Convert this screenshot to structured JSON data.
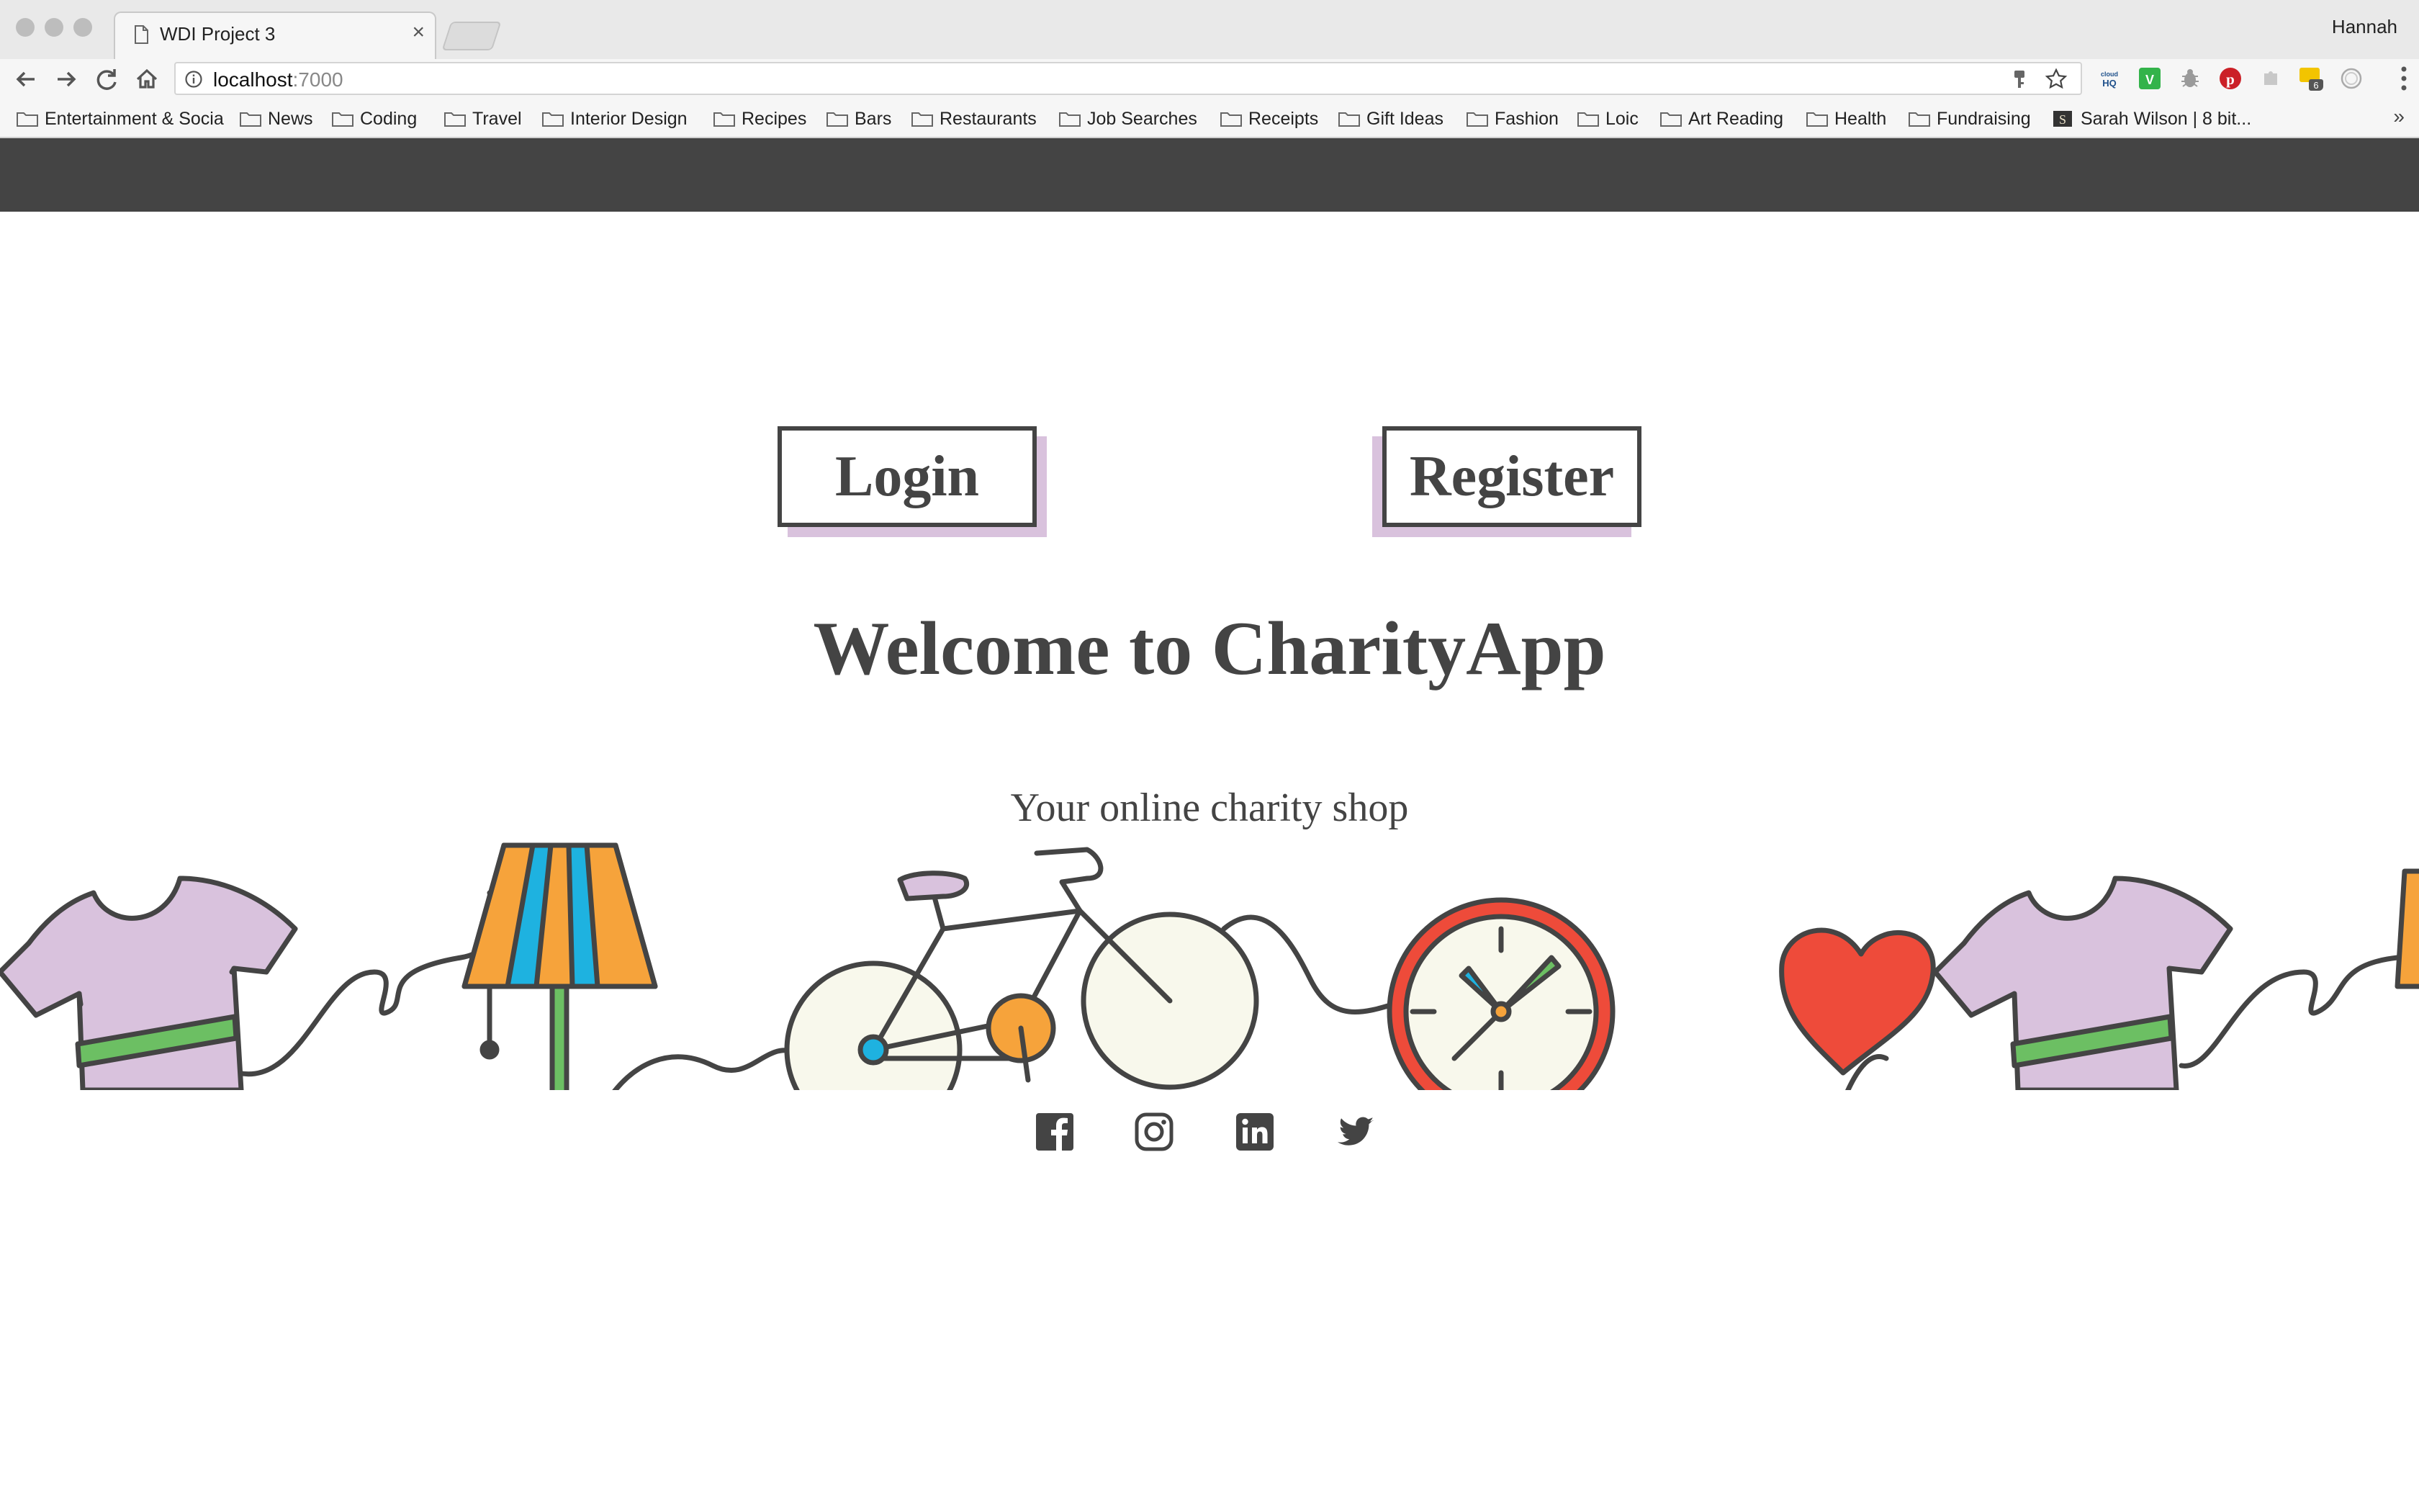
{
  "browser": {
    "tab_title": "WDI Project 3",
    "tab_close": "×",
    "profile_name": "Hannah",
    "url_host": "localhost",
    "url_port": ":7000",
    "bookmarks": [
      "Entertainment & Socia",
      "News",
      "Coding",
      "Travel",
      "Interior Design",
      "Recipes",
      "Bars",
      "Restaurants",
      "Job Searches",
      "Receipts",
      "Gift Ideas",
      "Fashion",
      "Loic",
      "Art Reading",
      "Health",
      "Fundraising",
      "Sarah Wilson | 8 bit..."
    ],
    "bookmarks_more": "»",
    "extensions": [
      "cloudHQ",
      "V",
      "bug",
      "pinterest",
      "puzzle",
      "6",
      "circle"
    ],
    "extension_badge": "6"
  },
  "page": {
    "login_label": "Login",
    "register_label": "Register",
    "headline": "Welcome to CharityApp",
    "tagline": "Your online charity shop",
    "illustration_items": [
      "t-shirt-icon",
      "lamp-icon",
      "bicycle-icon",
      "clock-icon",
      "heart-icon",
      "t-shirt-icon"
    ],
    "social_links": [
      "facebook-icon",
      "instagram-icon",
      "linkedin-icon",
      "twitter-icon"
    ]
  },
  "colors": {
    "navbar": "#444444",
    "button_shadow": "#d9c2dd",
    "text": "#444444",
    "shirt": "#d9c2dd",
    "green": "#6cbf63",
    "orange": "#f6a33b",
    "blue": "#1eb2e0",
    "red": "#ee4b3a",
    "cream": "#f8f8ec"
  }
}
